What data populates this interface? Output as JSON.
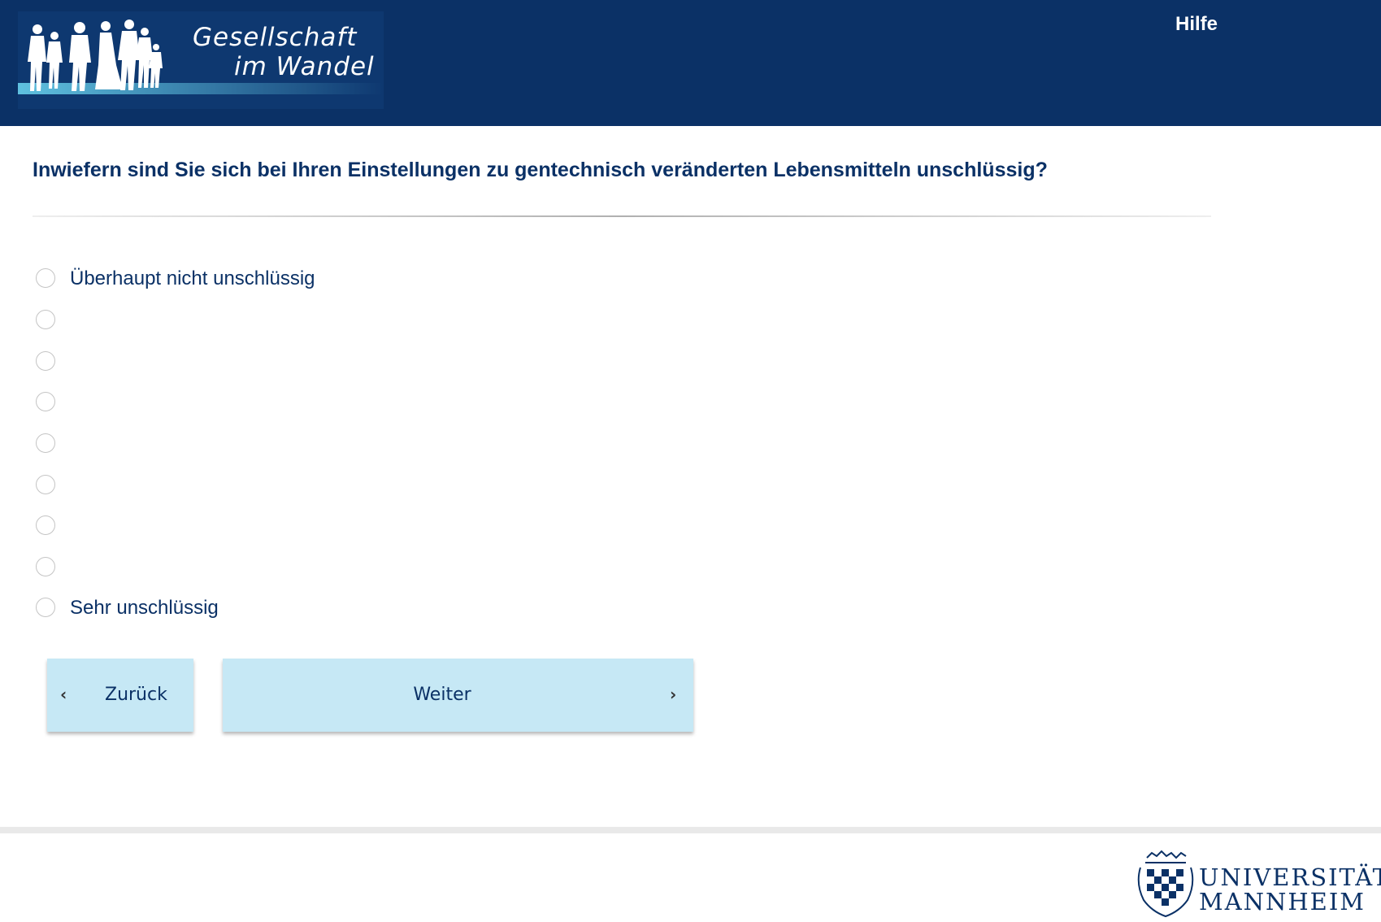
{
  "header": {
    "logo": {
      "line1": "Gesellschaft",
      "line2": "im Wandel"
    },
    "help_label": "Hilfe"
  },
  "question": {
    "text": "Inwiefern sind Sie sich bei Ihren Einstellungen zu gentechnisch veränderten Lebensmitteln unschlüssig?",
    "options": [
      {
        "label": "Überhaupt nicht unschlüssig",
        "selected": false
      },
      {
        "label": "",
        "selected": false
      },
      {
        "label": "",
        "selected": false
      },
      {
        "label": "",
        "selected": false
      },
      {
        "label": "",
        "selected": false
      },
      {
        "label": "",
        "selected": false
      },
      {
        "label": "",
        "selected": false
      },
      {
        "label": "",
        "selected": false
      },
      {
        "label": "Sehr unschlüssig",
        "selected": false
      }
    ]
  },
  "navigation": {
    "back_label": "Zurück",
    "next_label": "Weiter",
    "back_icon": "chevron-left-icon",
    "next_icon": "chevron-right-icon"
  },
  "footer": {
    "university_line1": "UNIVERSITÄT",
    "university_line2": "MANNHEIM"
  },
  "colors": {
    "header_bg": "#0b3166",
    "text_primary": "#0b3166",
    "button_bg": "#c6e8f5"
  }
}
